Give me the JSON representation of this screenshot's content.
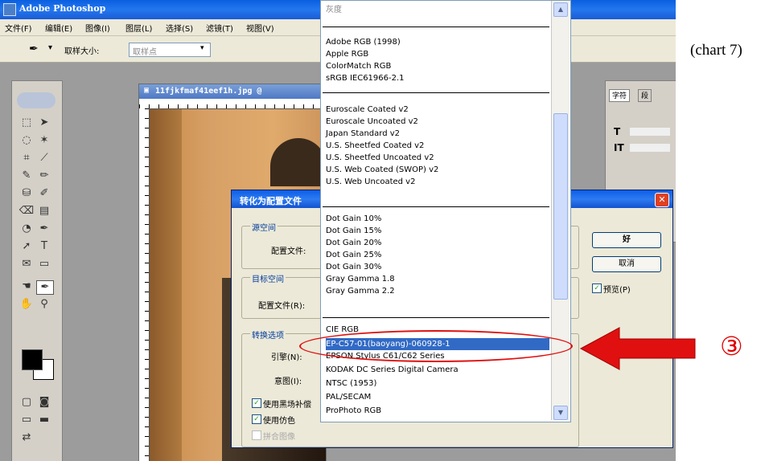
{
  "window": {
    "title": "Adobe Photoshop"
  },
  "menubar": [
    "文件(F)",
    "编辑(E)",
    "图像(I)",
    "图层(L)",
    "选择(S)",
    "滤镜(T)",
    "视图(V)"
  ],
  "options": {
    "label": "取样大小:",
    "value": "取样点"
  },
  "document": {
    "title": "11fjkfmaf41eef1h.jpg @"
  },
  "right_panel": {
    "tabs": [
      "字符",
      "段"
    ]
  },
  "dialog": {
    "title": "转化为配置文件",
    "groups": {
      "source": {
        "label": "源空间",
        "field_label": "配置文件:"
      },
      "target": {
        "label": "目标空间",
        "field_label": "配置文件(R):"
      },
      "conversion": {
        "label": "转换选项",
        "engine_label": "引擎(N):",
        "intent_label": "意图(I):",
        "checkbox_bpc": "使用黑场补偿",
        "checkbox_dither": "使用仿色",
        "checkbox_flatten": "拼合图像"
      }
    },
    "ok_button": "好",
    "cancel_button": "取消",
    "preview_label": "预览(P)"
  },
  "dropdown": {
    "top_item": "灰度",
    "groups": [
      [
        "Adobe RGB (1998)",
        "Apple RGB",
        "ColorMatch RGB",
        "sRGB IEC61966-2.1"
      ],
      [
        "Euroscale Coated v2",
        "Euroscale Uncoated v2",
        "Japan Standard v2",
        "U.S. Sheetfed Coated v2",
        "U.S. Sheetfed Uncoated v2",
        "U.S. Web Coated (SWOP) v2",
        "U.S. Web Uncoated v2"
      ],
      [
        "Dot Gain 10%",
        "Dot Gain 15%",
        "Dot Gain 20%",
        "Dot Gain 25%",
        "Dot Gain 30%",
        "Gray Gamma 1.8",
        "Gray Gamma 2.2"
      ],
      [
        "CIE RGB",
        "EP-C57-01(baoyang)-060928-1",
        "EPSON Stylus C61/C62 Series",
        "KODAK DC Series Digital Camera",
        "NTSC (1953)",
        "PAL/SECAM",
        "ProPhoto RGB"
      ]
    ],
    "selected": "EP-C57-01(baoyang)-060928-1"
  },
  "annotation": {
    "marker": "③",
    "arrow_color": "#e01010"
  },
  "caption": "(chart 7)"
}
